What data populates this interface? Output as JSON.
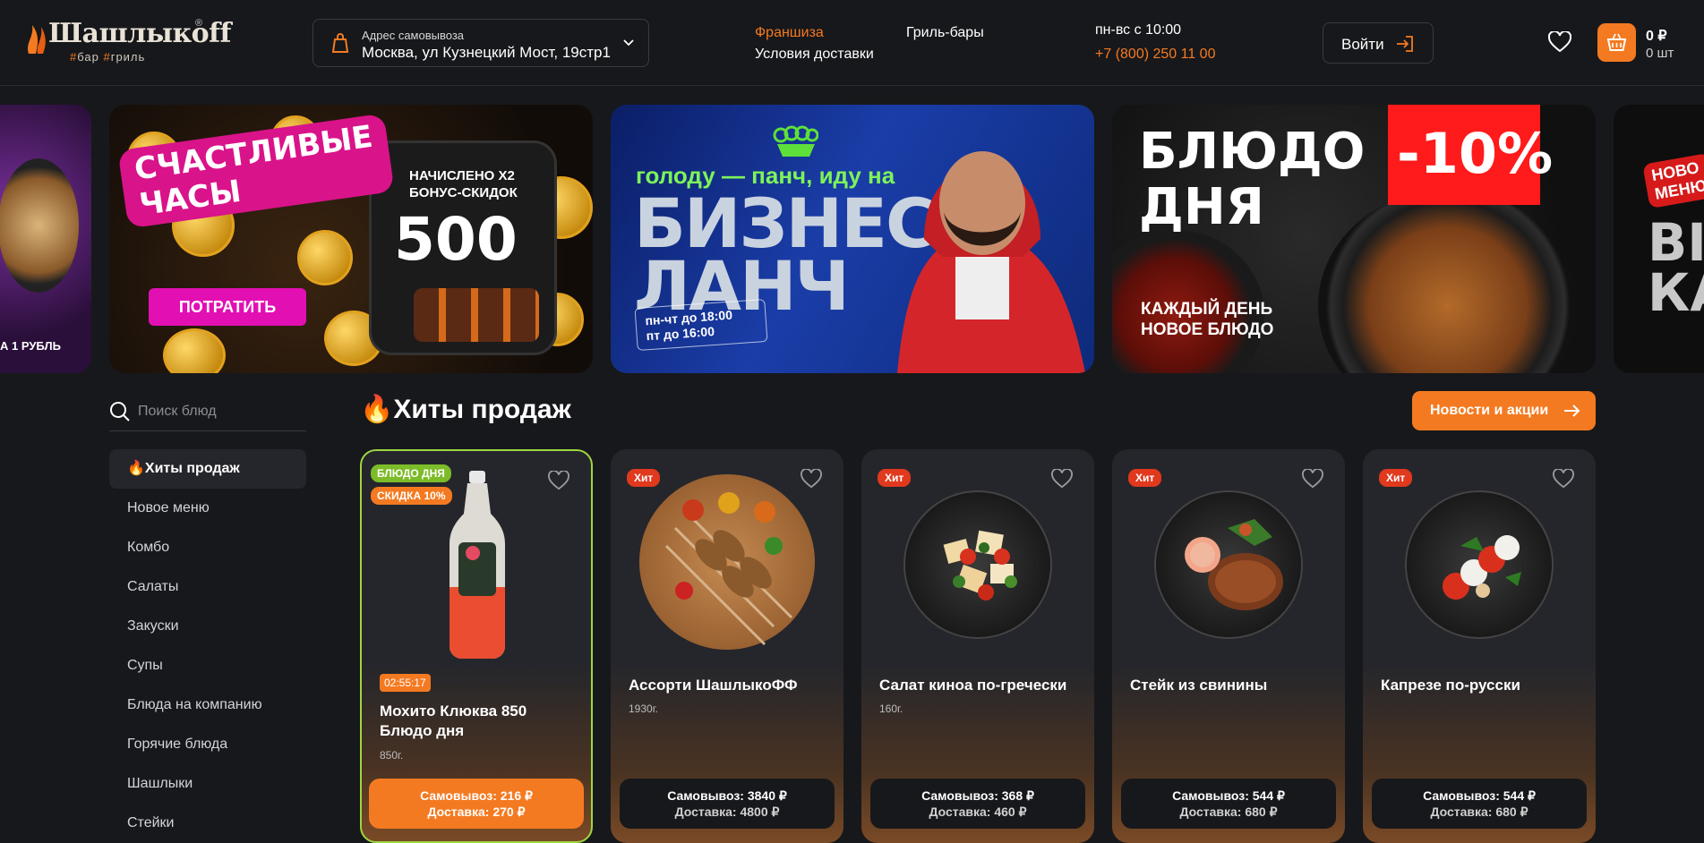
{
  "header": {
    "logo_text": "Шашлыкoff",
    "logo_sub_parts": [
      "#",
      "бар ",
      "#",
      "гриль"
    ],
    "address_label": "Адрес самовывоза",
    "address_value": "Москва, ул Кузнецкий Мост, 19стр1",
    "links": {
      "franchise": "Франшиза",
      "delivery_terms": "Условия доставки",
      "grill_bars": "Гриль-бары"
    },
    "hours": "пн-вс с 10:00",
    "phone": "+7 (800) 250 11 00",
    "login_label": "Войти",
    "cart_sum": "0 ₽",
    "cart_count": "0 шт"
  },
  "banners": [
    {
      "text": "А 1 РУБЛЬ"
    },
    {
      "headline": "СЧАСТЛИВЫЕ ЧАСЫ",
      "line1": "НАЧИСЛЕНО Х2",
      "line2": "БОНУС-СКИДОК",
      "amount": "500",
      "button": "ПОТРАТИТЬ"
    },
    {
      "line": "голоду — панч, иду на",
      "big1": "БИЗНЕС",
      "big2": "ЛАНЧ",
      "hours1": "пн-чт до 18:00",
      "hours2": "пт до 16:00"
    },
    {
      "big1": "БЛЮДО",
      "big2": "ДНЯ",
      "discount": "-10%",
      "sub1": "КАЖДЫЙ ДЕНЬ",
      "sub2": "НОВОЕ БЛЮДО"
    },
    {
      "tag1": "НОВО",
      "tag2": "МЕНЮ",
      "big1": "ВІ",
      "big2": "КА"
    }
  ],
  "sidebar": {
    "search_placeholder": "Поиск блюд",
    "items": [
      {
        "label": "🔥Хиты продаж"
      },
      {
        "label": "Новое меню"
      },
      {
        "label": "Комбо"
      },
      {
        "label": "Салаты"
      },
      {
        "label": "Закуски"
      },
      {
        "label": "Супы"
      },
      {
        "label": "Блюда на компанию"
      },
      {
        "label": "Горячие блюда"
      },
      {
        "label": "Шашлыки"
      },
      {
        "label": "Стейки"
      }
    ]
  },
  "main": {
    "title": "🔥Хиты продаж",
    "news_button": "Новости и акции",
    "products": [
      {
        "name": "Мохито Клюква 850 Блюдо дня",
        "weight": "850г.",
        "badge1": "БЛЮДО ДНЯ",
        "badge2": "СКИДКА 10%",
        "timer": "02:55:17",
        "pickup": "Самовывоз: 216 ₽",
        "delivery": "Доставка: 270 ₽"
      },
      {
        "name": "Ассорти ШашлыкоФФ",
        "weight": "1930г.",
        "badge": "Хит",
        "pickup": "Самовывоз: 3840 ₽",
        "delivery": "Доставка: 4800 ₽"
      },
      {
        "name": "Салат киноа по-гречески",
        "weight": "160г.",
        "badge": "Хит",
        "pickup": "Самовывоз: 368 ₽",
        "delivery": "Доставка: 460 ₽"
      },
      {
        "name": "Стейк из свинины",
        "weight": "",
        "badge": "Хит",
        "pickup": "Самовывоз: 544 ₽",
        "delivery": "Доставка: 680 ₽"
      },
      {
        "name": "Капрезе по-русски",
        "weight": "",
        "badge": "Хит",
        "pickup": "Самовывоз: 544 ₽",
        "delivery": "Доставка: 680 ₽"
      }
    ]
  },
  "colors": {
    "accent": "#f47a21",
    "background": "#17181b",
    "card": "#25262b",
    "hit_badge": "#e0391e",
    "day_badge": "#7cbc28"
  }
}
